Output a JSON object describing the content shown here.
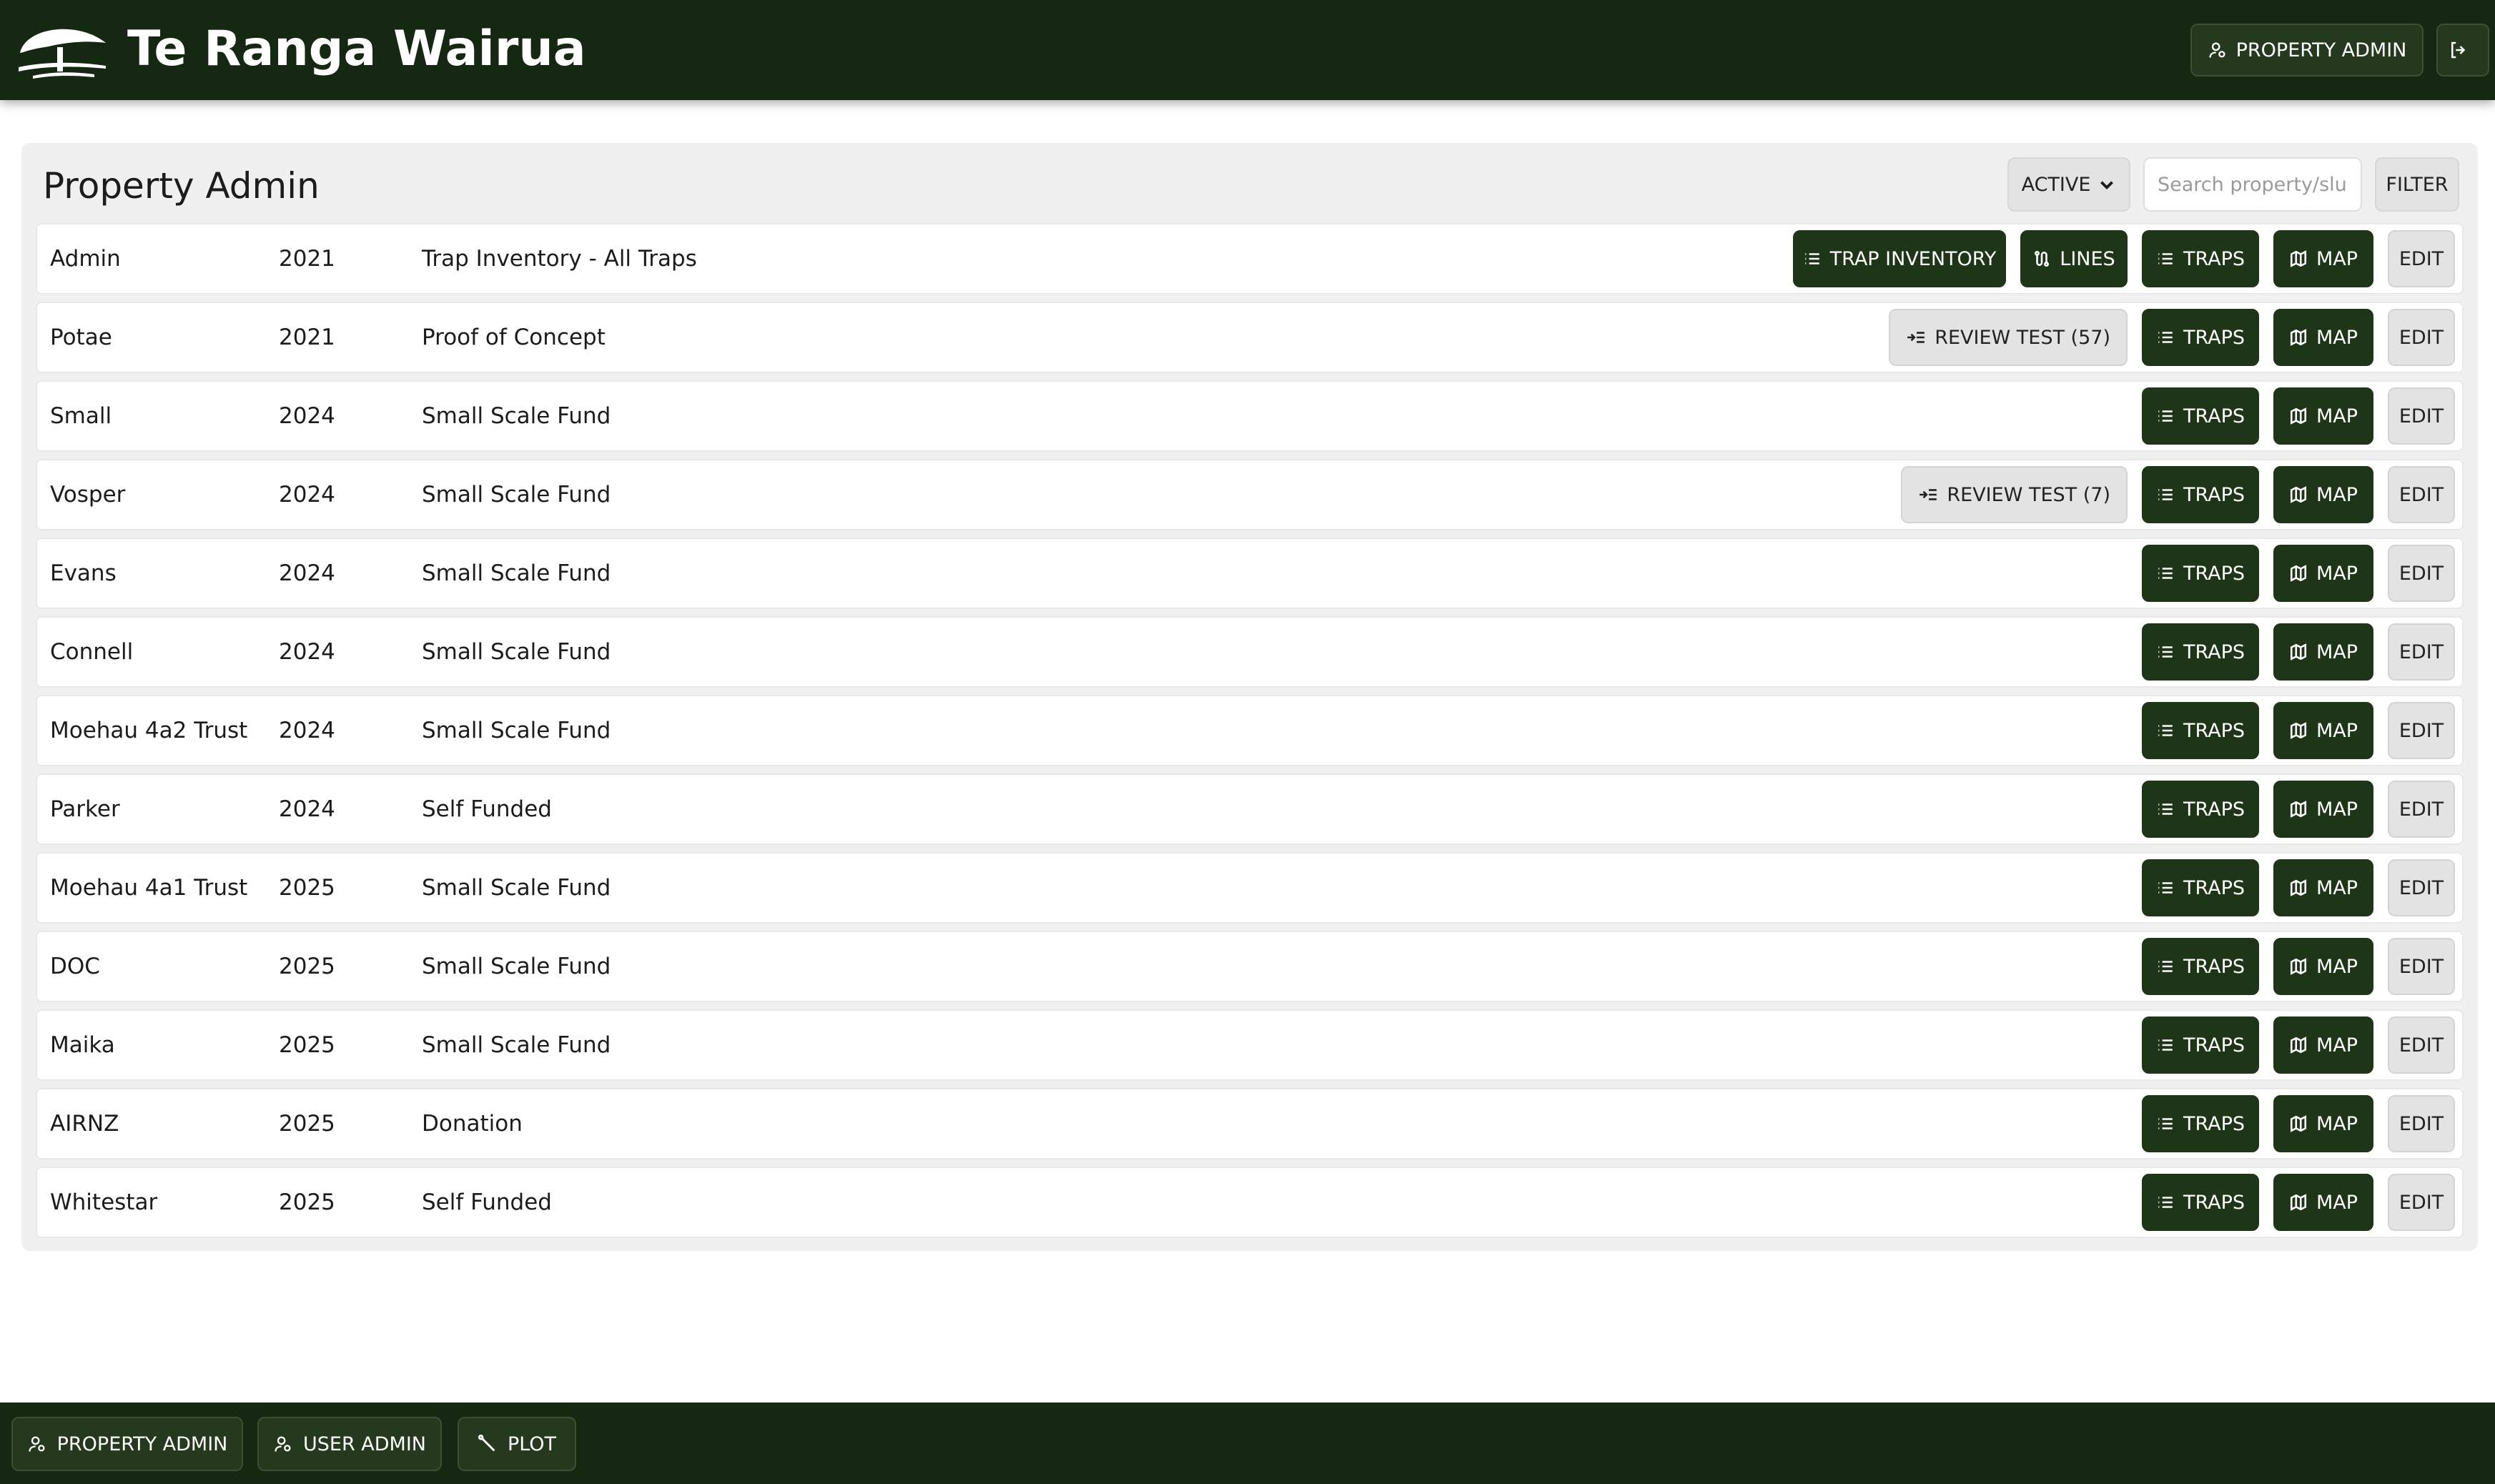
{
  "header": {
    "brand": "Te Ranga Wairua",
    "property_admin_label": "PROPERTY ADMIN"
  },
  "panel": {
    "title": "Property Admin",
    "status_filter": "ACTIVE",
    "search_placeholder": "Search property/slug",
    "filter_label": "FILTER"
  },
  "labels": {
    "trap_inventory": "TRAP INVENTORY",
    "lines": "LINES",
    "traps": "TRAPS",
    "map": "MAP",
    "edit": "EDIT"
  },
  "rows": [
    {
      "name": "Admin",
      "year": "2021",
      "fund": "Trap Inventory - All Traps"
    },
    {
      "name": "Potae",
      "year": "2021",
      "fund": "Proof of Concept",
      "review": "REVIEW TEST (57)"
    },
    {
      "name": "Small",
      "year": "2024",
      "fund": "Small Scale Fund"
    },
    {
      "name": "Vosper",
      "year": "2024",
      "fund": "Small Scale Fund",
      "review": "REVIEW TEST (7)"
    },
    {
      "name": "Evans",
      "year": "2024",
      "fund": "Small Scale Fund"
    },
    {
      "name": "Connell",
      "year": "2024",
      "fund": "Small Scale Fund"
    },
    {
      "name": "Moehau 4a2 Trust",
      "year": "2024",
      "fund": "Small Scale Fund"
    },
    {
      "name": "Parker",
      "year": "2024",
      "fund": "Self Funded"
    },
    {
      "name": "Moehau 4a1 Trust",
      "year": "2025",
      "fund": "Small Scale Fund"
    },
    {
      "name": "DOC",
      "year": "2025",
      "fund": "Small Scale Fund"
    },
    {
      "name": "Maika",
      "year": "2025",
      "fund": "Small Scale Fund"
    },
    {
      "name": "AIRNZ",
      "year": "2025",
      "fund": "Donation"
    },
    {
      "name": "Whitestar",
      "year": "2025",
      "fund": "Self Funded"
    }
  ],
  "footer": {
    "property_admin": "PROPERTY ADMIN",
    "user_admin": "USER ADMIN",
    "plot": "PLOT"
  },
  "icons": {
    "logo": "tree-logo-icon",
    "admin": "user-gear-icon",
    "logout": "logout-icon",
    "dropdown": "chevron-down-icon",
    "list": "list-icon",
    "lines": "route-icon",
    "map": "map-icon",
    "review": "review-icon",
    "plot": "plot-line-icon"
  },
  "colors": {
    "header_bg": "#152811",
    "button_dark": "#1e3518",
    "button_light": "#e3e3e3",
    "panel_bg": "#f0f0f0"
  }
}
